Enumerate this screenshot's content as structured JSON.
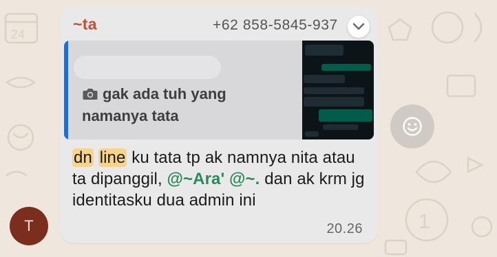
{
  "message": {
    "sender_name": "~ta",
    "sender_phone": "+62 858-5845-937",
    "quoted": {
      "text": "gak ada tuh yang namanya tata",
      "icon": "camera-icon",
      "accent_color": "#1f6fd9"
    },
    "body": {
      "highlight_1": "dn",
      "highlight_2": "line",
      "part_1": " ku tata tp ak namnya nita atau ta dipanggil, ",
      "mention_1": "@~Ara'",
      "part_2": " ",
      "mention_2": "@~.",
      "part_3": " dan ak krm jg identitasku dua admin ini"
    },
    "time": "20.26"
  },
  "avatar": {
    "initial": "T",
    "color": "#7b2d1e"
  },
  "actions": {
    "reaction_icon": "smiley-icon",
    "menu_icon": "chevron-down-icon"
  },
  "colors": {
    "sender": "#c0513b",
    "mention": "#2a8a57",
    "highlight": "#f7d38b",
    "bubble": "#e9e9ea",
    "wallpaper": "#efe7dd"
  }
}
